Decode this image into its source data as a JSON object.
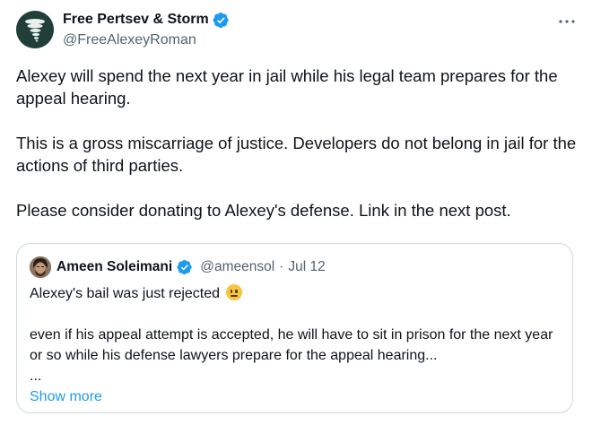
{
  "author": {
    "name": "Free Pertsev & Storm",
    "handle": "@FreeAlexeyRoman",
    "verified": true,
    "avatar_icon": "tornado-logo-icon"
  },
  "more_button_label": "···",
  "tweet": {
    "paragraphs": [
      "Alexey will spend the next year in jail while his legal team prepares for the appeal hearing.",
      "This is a gross miscarriage of justice. Developers do not belong in jail for the actions of third parties.",
      "Please consider donating to Alexey's defense. Link in the next post."
    ]
  },
  "quote": {
    "author_name": "Ameen Soleimani",
    "handle": "@ameensol",
    "separator": "·",
    "date": "Jul 12",
    "verified": true,
    "line1": "Alexey's bail was just rejected",
    "line1_emoji": "neutral-face-icon",
    "line2": "even if his appeal attempt is accepted, he will have to sit in prison for the next year or so while his defense lawyers prepare for the appeal hearing...",
    "line3": "...",
    "show_more": "Show more"
  },
  "colors": {
    "text": "#0f1419",
    "secondary": "#536471",
    "accent": "#1d9bf0",
    "border": "#cfd9de"
  }
}
